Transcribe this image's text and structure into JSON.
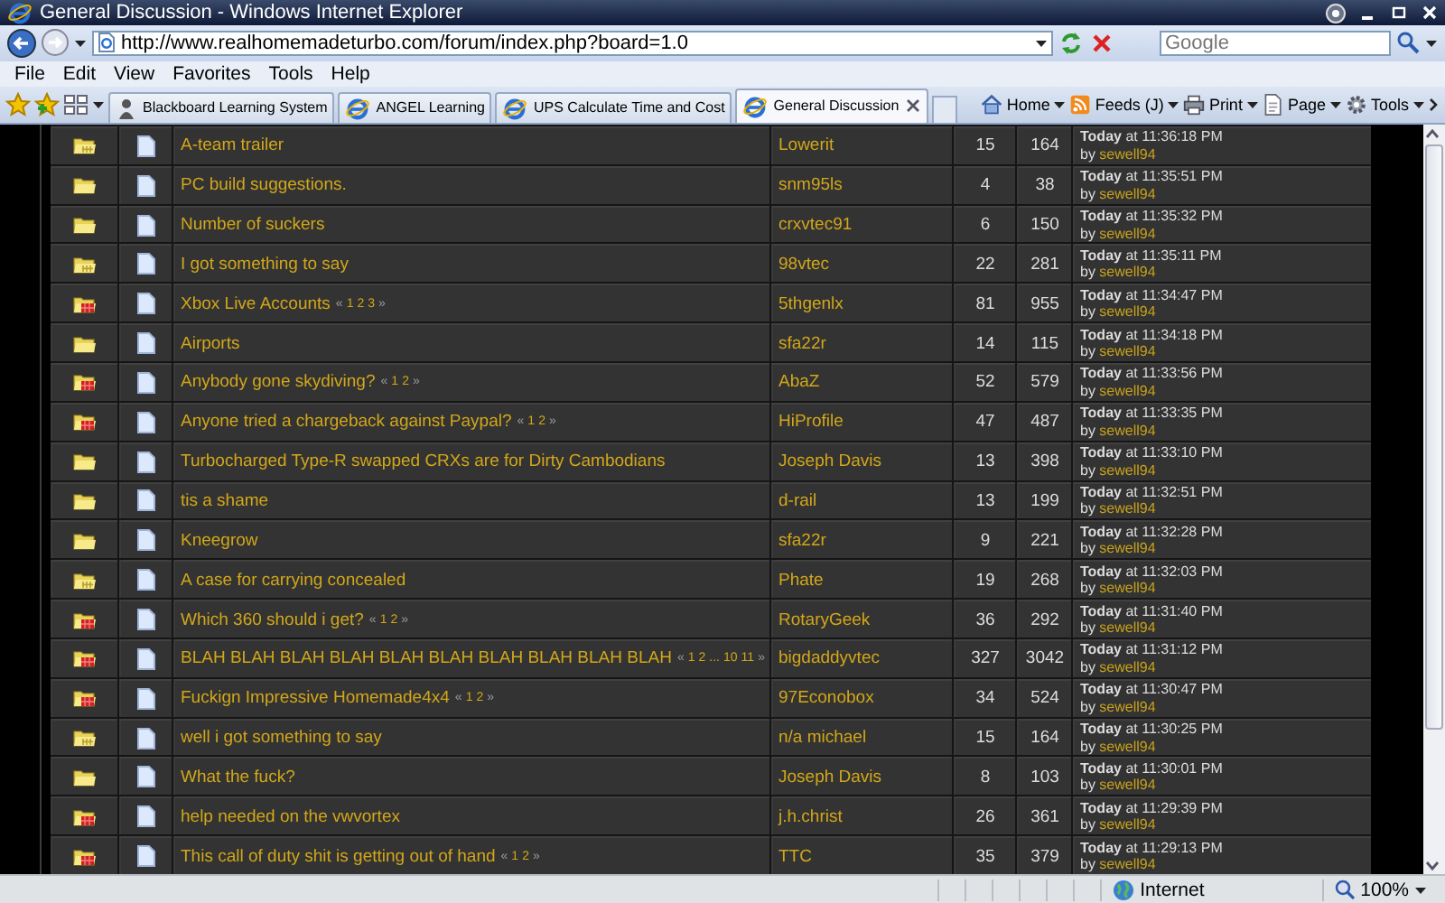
{
  "window": {
    "title": "General Discussion - Windows Internet Explorer"
  },
  "address_bar": {
    "url": "http://www.realhomemadeturbo.com/forum/index.php?board=1.0"
  },
  "search": {
    "placeholder": "Google"
  },
  "menu": [
    "File",
    "Edit",
    "View",
    "Favorites",
    "Tools",
    "Help"
  ],
  "tabs": [
    {
      "label": "Blackboard Learning System",
      "selected": false,
      "kind": "figure"
    },
    {
      "label": "ANGEL Learning",
      "selected": false,
      "kind": "browser"
    },
    {
      "label": "UPS Calculate Time and Cost",
      "selected": false,
      "kind": "browser"
    },
    {
      "label": "General Discussion",
      "selected": true,
      "kind": "browser"
    }
  ],
  "command_bar": [
    {
      "label": "Home",
      "kind": "home"
    },
    {
      "label": "Feeds (J)",
      "kind": "feeds"
    },
    {
      "label": "Print",
      "kind": "print"
    },
    {
      "label": "Page",
      "kind": "page"
    },
    {
      "label": "Tools",
      "kind": "tools"
    }
  ],
  "topics": [
    {
      "kind": "hot",
      "subject": "A-team trailer",
      "starter": "Lowerit",
      "replies": "15",
      "views": "164",
      "last_post": {
        "time": "**Today** at 11:36:18 PM",
        "by": "by",
        "user": "sewell94"
      }
    },
    {
      "kind": "normal",
      "subject": "PC build suggestions.",
      "starter": "snm95ls",
      "replies": "4",
      "views": "38",
      "last_post": {
        "time": "**Today** at 11:35:51 PM",
        "by": "by",
        "user": "sewell94"
      }
    },
    {
      "kind": "normal",
      "subject": "Number of suckers",
      "starter": "crxvtec91",
      "replies": "6",
      "views": "150",
      "last_post": {
        "time": "**Today** at 11:35:32 PM",
        "by": "by",
        "user": "sewell94"
      }
    },
    {
      "kind": "hot",
      "subject": "I got something to say",
      "starter": "98vtec",
      "replies": "22",
      "views": "281",
      "last_post": {
        "time": "**Today** at 11:35:11 PM",
        "by": "by",
        "user": "sewell94"
      }
    },
    {
      "kind": "very_hot",
      "subject": "Xbox Live Accounts",
      "pages": {
        "open": "«",
        "links": [
          "1",
          "2",
          "3"
        ],
        "close": "»"
      },
      "starter": "5thgenlx",
      "replies": "81",
      "views": "955",
      "last_post": {
        "time": "**Today** at 11:34:47 PM",
        "by": "by",
        "user": "sewell94"
      }
    },
    {
      "kind": "normal",
      "subject": "Airports",
      "starter": "sfa22r",
      "replies": "14",
      "views": "115",
      "last_post": {
        "time": "**Today** at 11:34:18 PM",
        "by": "by",
        "user": "sewell94"
      }
    },
    {
      "kind": "very_hot",
      "subject": "Anybody gone skydiving?",
      "pages": {
        "open": "«",
        "links": [
          "1",
          "2"
        ],
        "close": "»"
      },
      "starter": "AbaZ",
      "replies": "52",
      "views": "579",
      "last_post": {
        "time": "**Today** at 11:33:56 PM",
        "by": "by",
        "user": "sewell94"
      }
    },
    {
      "kind": "very_hot",
      "subject": "Anyone tried a chargeback against Paypal?",
      "pages": {
        "open": "«",
        "links": [
          "1",
          "2"
        ],
        "close": "»"
      },
      "starter": "HiProfile",
      "replies": "47",
      "views": "487",
      "last_post": {
        "time": "**Today** at 11:33:35 PM",
        "by": "by",
        "user": "sewell94"
      }
    },
    {
      "kind": "normal",
      "subject": "Turbocharged Type-R swapped CRXs are for Dirty Cambodians",
      "starter": "Joseph Davis",
      "replies": "13",
      "views": "398",
      "last_post": {
        "time": "**Today** at 11:33:10 PM",
        "by": "by",
        "user": "sewell94"
      }
    },
    {
      "kind": "normal",
      "subject": "tis a shame",
      "starter": "d-rail",
      "replies": "13",
      "views": "199",
      "last_post": {
        "time": "**Today** at 11:32:51 PM",
        "by": "by",
        "user": "sewell94"
      }
    },
    {
      "kind": "normal",
      "subject": "Kneegrow",
      "starter": "sfa22r",
      "replies": "9",
      "views": "221",
      "last_post": {
        "time": "**Today** at 11:32:28 PM",
        "by": "by",
        "user": "sewell94"
      }
    },
    {
      "kind": "hot",
      "subject": "A case for carrying concealed",
      "starter": "Phate",
      "replies": "19",
      "views": "268",
      "last_post": {
        "time": "**Today** at 11:32:03 PM",
        "by": "by",
        "user": "sewell94"
      }
    },
    {
      "kind": "very_hot",
      "subject": "Which 360 should i get?",
      "pages": {
        "open": "«",
        "links": [
          "1",
          "2"
        ],
        "close": "»"
      },
      "starter": "RotaryGeek",
      "replies": "36",
      "views": "292",
      "last_post": {
        "time": "**Today** at 11:31:40 PM",
        "by": "by",
        "user": "sewell94"
      }
    },
    {
      "kind": "very_hot",
      "subject": "BLAH BLAH BLAH BLAH BLAH BLAH BLAH BLAH BLAH BLAH",
      "pages": {
        "open": "«",
        "links": [
          "1",
          "2",
          "...",
          "10",
          "11"
        ],
        "close": "»"
      },
      "starter": "bigdaddyvtec",
      "replies": "327",
      "views": "3042",
      "last_post": {
        "time": "**Today** at 11:31:12 PM",
        "by": "by",
        "user": "sewell94"
      }
    },
    {
      "kind": "very_hot",
      "subject": "Fuckign Impressive Homemade4x4",
      "pages": {
        "open": "«",
        "links": [
          "1",
          "2"
        ],
        "close": "»"
      },
      "starter": "97Econobox",
      "replies": "34",
      "views": "524",
      "last_post": {
        "time": "**Today** at 11:30:47 PM",
        "by": "by",
        "user": "sewell94"
      }
    },
    {
      "kind": "hot",
      "subject": "well i got something to say",
      "starter": "n/a michael",
      "replies": "15",
      "views": "164",
      "last_post": {
        "time": "**Today** at 11:30:25 PM",
        "by": "by",
        "user": "sewell94"
      }
    },
    {
      "kind": "normal",
      "subject": "What the fuck?",
      "starter": "Joseph Davis",
      "replies": "8",
      "views": "103",
      "last_post": {
        "time": "**Today** at 11:30:01 PM",
        "by": "by",
        "user": "sewell94"
      }
    },
    {
      "kind": "very_hot",
      "subject": "help needed on the vwvortex",
      "starter": "j.h.christ",
      "replies": "26",
      "views": "361",
      "last_post": {
        "time": "**Today** at 11:29:39 PM",
        "by": "by",
        "user": "sewell94"
      }
    },
    {
      "kind": "very_hot",
      "subject": "This call of duty shit is getting out of hand",
      "pages": {
        "open": "«",
        "links": [
          "1",
          "2"
        ],
        "close": "»"
      },
      "starter": "TTC",
      "replies": "35",
      "views": "379",
      "last_post": {
        "time": "**Today** at 11:29:13 PM",
        "by": "by",
        "user": "sewell94"
      }
    }
  ],
  "status_bar": {
    "zone": "Internet",
    "zoom": "100%"
  }
}
